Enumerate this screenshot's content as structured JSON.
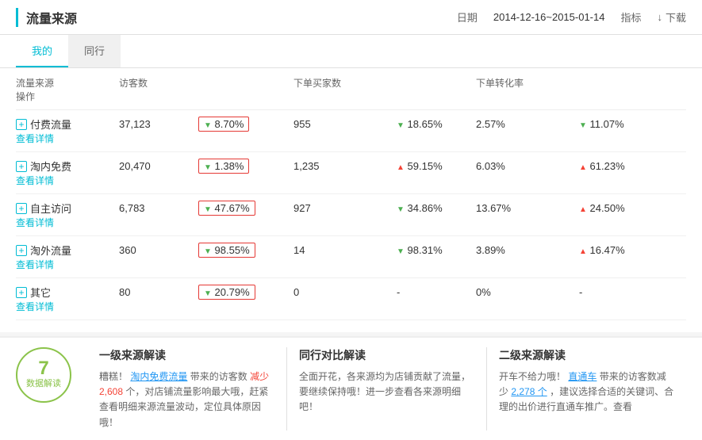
{
  "header": {
    "title": "流量来源",
    "date_label": "日期",
    "date_value": "2014-12-16~2015-01-14",
    "indicator_label": "指标",
    "download_label": "下载"
  },
  "tabs": [
    {
      "label": "我的",
      "active": true
    },
    {
      "label": "同行",
      "active": false
    }
  ],
  "table": {
    "columns": [
      "流量来源",
      "访客数",
      "",
      "下单买家数",
      "",
      "下单转化率",
      "",
      "操作"
    ],
    "rows": [
      {
        "source": "付费流量",
        "visitors": "37,123",
        "visitor_change": "8.70%",
        "visitor_trend": "down",
        "buyers": "955",
        "buyer_change": "18.65%",
        "buyer_trend": "down",
        "conversion": "2.57%",
        "conv_change": "11.07%",
        "conv_trend": "down",
        "action": "查看详情"
      },
      {
        "source": "淘内免费",
        "visitors": "20,470",
        "visitor_change": "1.38%",
        "visitor_trend": "down",
        "buyers": "1,235",
        "buyer_change": "59.15%",
        "buyer_trend": "up",
        "conversion": "6.03%",
        "conv_change": "61.23%",
        "conv_trend": "up",
        "action": "查看详情"
      },
      {
        "source": "自主访问",
        "visitors": "6,783",
        "visitor_change": "47.67%",
        "visitor_trend": "down",
        "buyers": "927",
        "buyer_change": "34.86%",
        "buyer_trend": "down",
        "conversion": "13.67%",
        "conv_change": "24.50%",
        "conv_trend": "up",
        "action": "查看详情"
      },
      {
        "source": "淘外流量",
        "visitors": "360",
        "visitor_change": "98.55%",
        "visitor_trend": "down",
        "buyers": "14",
        "buyer_change": "98.31%",
        "buyer_trend": "down",
        "conversion": "3.89%",
        "conv_change": "16.47%",
        "conv_trend": "up",
        "action": "查看详情"
      },
      {
        "source": "其它",
        "visitors": "80",
        "visitor_change": "20.79%",
        "visitor_trend": "down",
        "buyers": "0",
        "buyer_change": "-",
        "buyer_trend": "none",
        "conversion": "0%",
        "conv_change": "-",
        "conv_trend": "none",
        "action": "查看详情"
      }
    ]
  },
  "bottom": {
    "days": "7",
    "days_label": "数据解读",
    "card1": {
      "title": "一级来源解读",
      "text_prefix": "糟糕！",
      "text_highlight1": "淘内免费流量",
      "text_mid": "带来的访客数",
      "text_highlight2": "减少2,608",
      "text_suffix": "个，对店铺流量影响最大哦，赶紧查看明细来源流量波动，定位具体原因哦！"
    },
    "card2": {
      "title": "同行对比解读",
      "text": "全面开花，各来源均为店铺贡献了流量，要继续保持哦！进一步查看各来源明细吧！"
    },
    "card3": {
      "title": "二级来源解读",
      "text_prefix": "开车不给力哦！",
      "text_highlight1": "直通车",
      "text_mid": "带来的访客数减少",
      "text_highlight2": "2,278 个",
      "text_suffix": "，建议选择合适的关键词、合理的出价进行直通车推广。查看"
    }
  }
}
